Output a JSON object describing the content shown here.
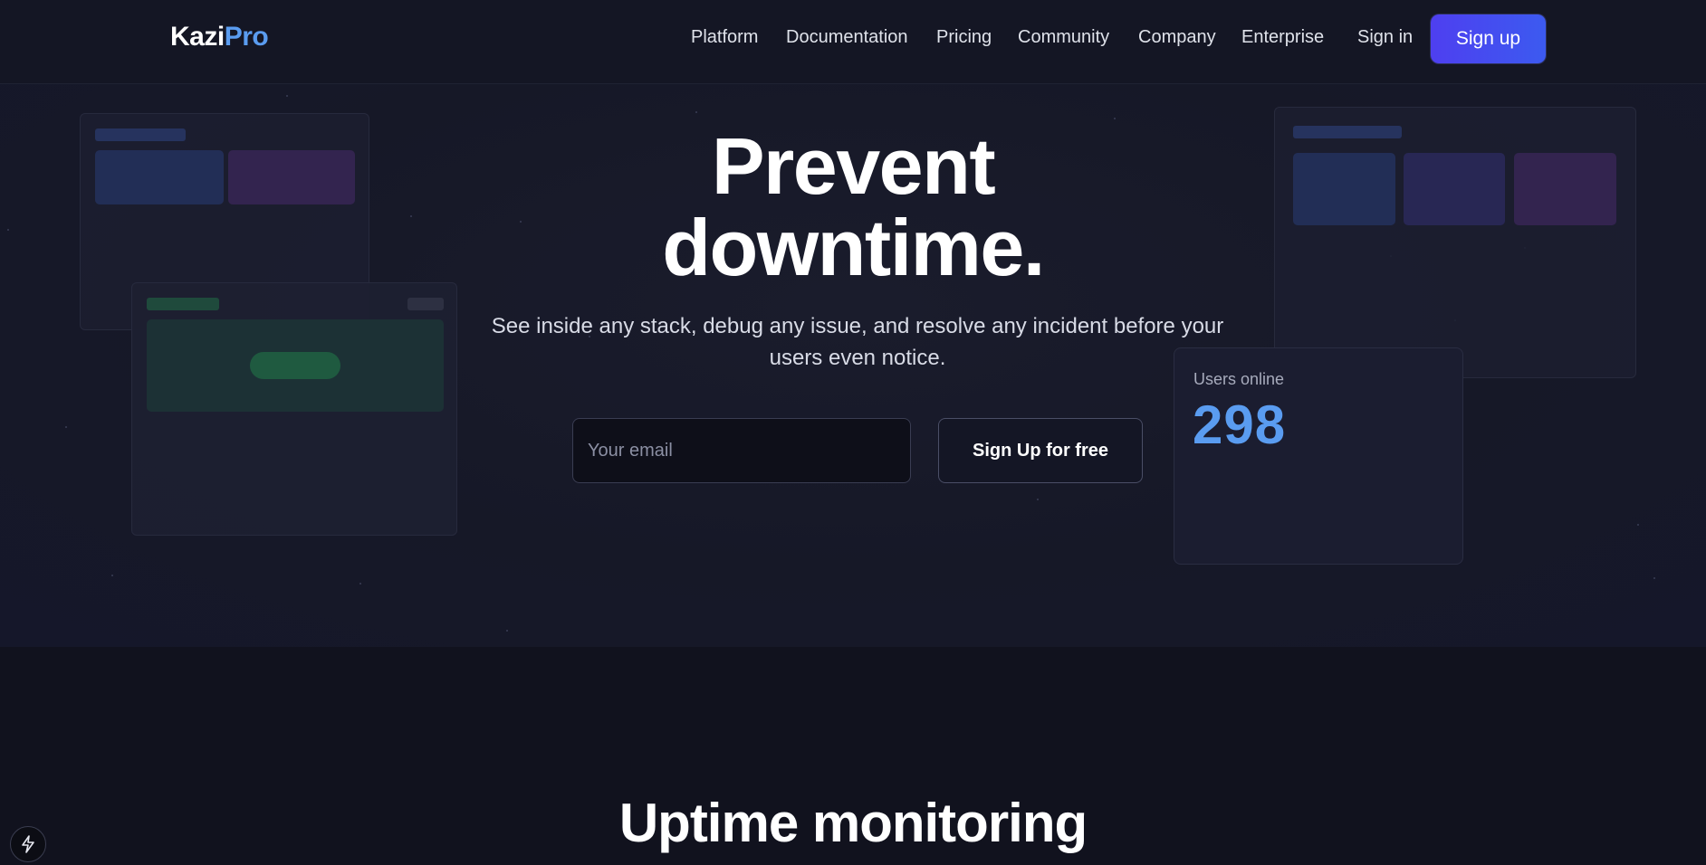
{
  "brand": {
    "name_part1": "Kazi",
    "name_part2": "Pro"
  },
  "nav": {
    "links": [
      "Platform",
      "Documentation",
      "Pricing",
      "Community",
      "Company",
      "Enterprise"
    ],
    "sign_in": "Sign in",
    "sign_up": "Sign up"
  },
  "hero": {
    "title_line1": "Prevent",
    "title_line2": "downtime.",
    "subtitle": "See inside any stack, debug any issue, and resolve any incident before your users even notice.",
    "email_placeholder": "Your email",
    "cta_label": "Sign Up for free"
  },
  "users_card": {
    "label": "Users online",
    "count": "298"
  },
  "section": {
    "title": "Uptime monitoring"
  },
  "icons": {
    "dev_badge": "lightning-bolt-icon"
  },
  "colors": {
    "accent": "#5a9cf0",
    "button_gradient_start": "#4e3ff0",
    "button_gradient_end": "#3c5af0",
    "background": "#11121e"
  }
}
